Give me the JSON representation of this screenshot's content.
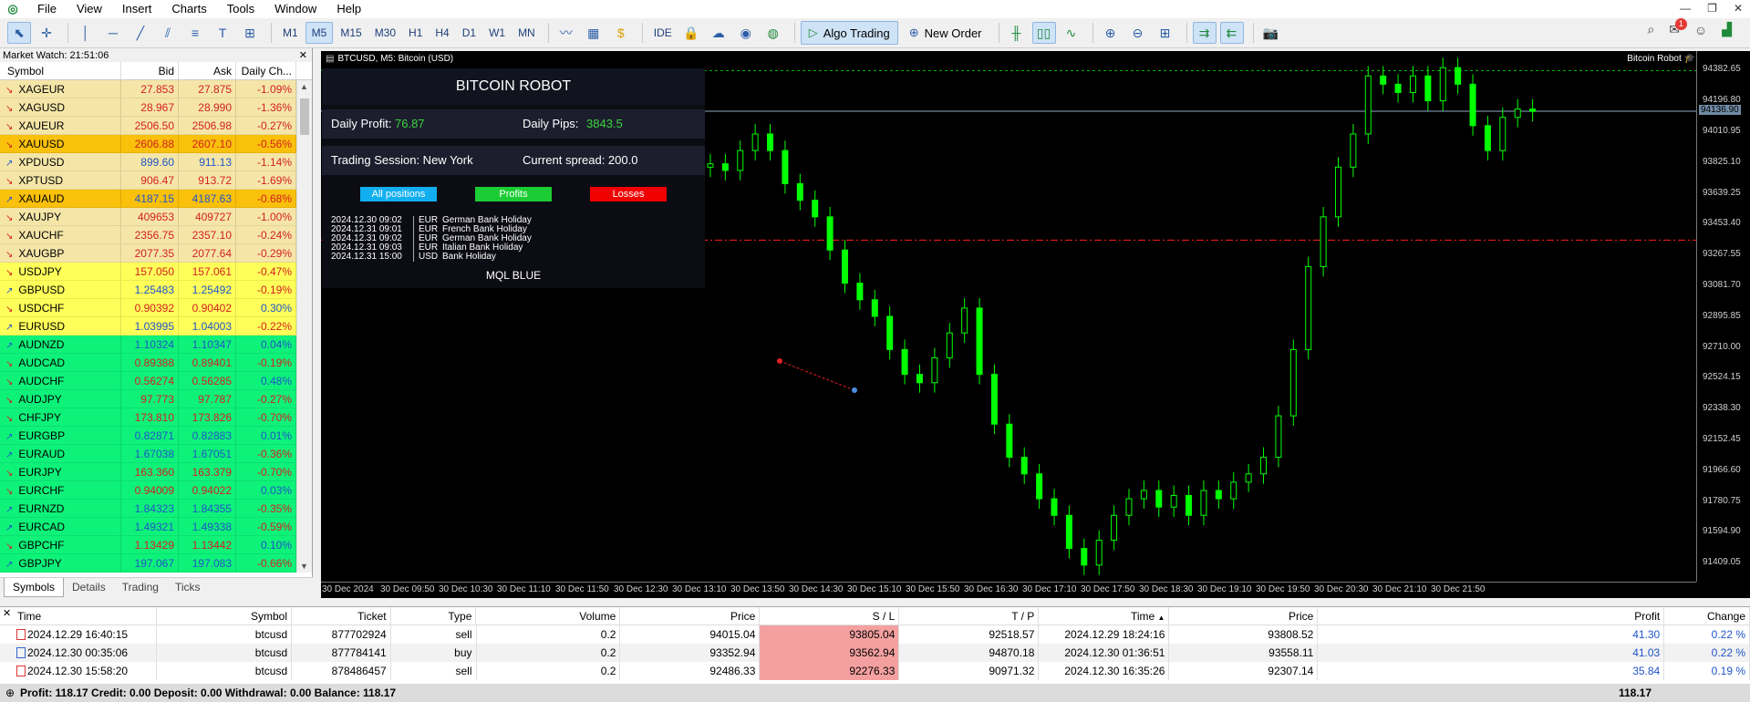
{
  "menu": {
    "items": [
      "File",
      "View",
      "Insert",
      "Charts",
      "Tools",
      "Window",
      "Help"
    ]
  },
  "toolbar": {
    "timeframes": [
      "M1",
      "M5",
      "M15",
      "M30",
      "H1",
      "H4",
      "D1",
      "W1",
      "MN"
    ],
    "active_timeframe": "M5",
    "ide_label": "IDE",
    "algo_trading_label": "Algo Trading",
    "new_order_label": "New Order",
    "notification_count": "1"
  },
  "market_watch": {
    "title": "Market Watch: 21:51:06",
    "columns": [
      "Symbol",
      "Bid",
      "Ask",
      "Daily Ch..."
    ],
    "rows": [
      {
        "symbol": "XAGEUR",
        "bid": "27.853",
        "ask": "27.875",
        "change": "-1.09%",
        "dir": "down",
        "bg": "#f5e6a8"
      },
      {
        "symbol": "XAGUSD",
        "bid": "28.967",
        "ask": "28.990",
        "change": "-1.36%",
        "dir": "down",
        "bg": "#f5e6a8"
      },
      {
        "symbol": "XAUEUR",
        "bid": "2506.50",
        "ask": "2506.98",
        "change": "-0.27%",
        "dir": "down",
        "bg": "#f5e6a8"
      },
      {
        "symbol": "XAUUSD",
        "bid": "2606.88",
        "ask": "2607.10",
        "change": "-0.56%",
        "dir": "down",
        "bg": "#f9c00c"
      },
      {
        "symbol": "XPDUSD",
        "bid": "899.60",
        "ask": "911.13",
        "change": "-1.14%",
        "dir": "up",
        "bg": "#f5e6a8"
      },
      {
        "symbol": "XPTUSD",
        "bid": "906.47",
        "ask": "913.72",
        "change": "-1.69%",
        "dir": "down",
        "bg": "#f5e6a8"
      },
      {
        "symbol": "XAUAUD",
        "bid": "4187.15",
        "ask": "4187.63",
        "change": "-0.68%",
        "dir": "up",
        "bg": "#f9c00c"
      },
      {
        "symbol": "XAUJPY",
        "bid": "409653",
        "ask": "409727",
        "change": "-1.00%",
        "dir": "down",
        "bg": "#f5e6a8"
      },
      {
        "symbol": "XAUCHF",
        "bid": "2356.75",
        "ask": "2357.10",
        "change": "-0.24%",
        "dir": "down",
        "bg": "#f5e6a8"
      },
      {
        "symbol": "XAUGBP",
        "bid": "2077.35",
        "ask": "2077.64",
        "change": "-0.29%",
        "dir": "down",
        "bg": "#f5e6a8"
      },
      {
        "symbol": "USDJPY",
        "bid": "157.050",
        "ask": "157.061",
        "change": "-0.47%",
        "dir": "down",
        "bg": "#ffff5a"
      },
      {
        "symbol": "GBPUSD",
        "bid": "1.25483",
        "ask": "1.25492",
        "change": "-0.19%",
        "dir": "up",
        "bg": "#ffff5a"
      },
      {
        "symbol": "USDCHF",
        "bid": "0.90392",
        "ask": "0.90402",
        "change": "0.30%",
        "dir": "down",
        "bg": "#ffff5a"
      },
      {
        "symbol": "EURUSD",
        "bid": "1.03995",
        "ask": "1.04003",
        "change": "-0.22%",
        "dir": "up",
        "bg": "#ffff5a"
      },
      {
        "symbol": "AUDNZD",
        "bid": "1.10324",
        "ask": "1.10347",
        "change": "0.04%",
        "dir": "up",
        "bg": "#0ef27a"
      },
      {
        "symbol": "AUDCAD",
        "bid": "0.89388",
        "ask": "0.89401",
        "change": "-0.19%",
        "dir": "down",
        "bg": "#0ef27a"
      },
      {
        "symbol": "AUDCHF",
        "bid": "0.56274",
        "ask": "0.56285",
        "change": "0.48%",
        "dir": "down",
        "bg": "#0ef27a"
      },
      {
        "symbol": "AUDJPY",
        "bid": "97.773",
        "ask": "97.787",
        "change": "-0.27%",
        "dir": "down",
        "bg": "#0ef27a"
      },
      {
        "symbol": "CHFJPY",
        "bid": "173.810",
        "ask": "173.826",
        "change": "-0.70%",
        "dir": "down",
        "bg": "#0ef27a"
      },
      {
        "symbol": "EURGBP",
        "bid": "0.82871",
        "ask": "0.82883",
        "change": "0.01%",
        "dir": "up",
        "bg": "#0ef27a"
      },
      {
        "symbol": "EURAUD",
        "bid": "1.67038",
        "ask": "1.67051",
        "change": "-0.36%",
        "dir": "up",
        "bg": "#0ef27a"
      },
      {
        "symbol": "EURJPY",
        "bid": "163.360",
        "ask": "163.379",
        "change": "-0.70%",
        "dir": "down",
        "bg": "#0ef27a"
      },
      {
        "symbol": "EURCHF",
        "bid": "0.94009",
        "ask": "0.94022",
        "change": "0.03%",
        "dir": "down",
        "bg": "#0ef27a"
      },
      {
        "symbol": "EURNZD",
        "bid": "1.84323",
        "ask": "1.84355",
        "change": "-0.35%",
        "dir": "up",
        "bg": "#0ef27a"
      },
      {
        "symbol": "EURCAD",
        "bid": "1.49321",
        "ask": "1.49338",
        "change": "-0.59%",
        "dir": "up",
        "bg": "#0ef27a"
      },
      {
        "symbol": "GBPCHF",
        "bid": "1.13429",
        "ask": "1.13442",
        "change": "0.10%",
        "dir": "down",
        "bg": "#0ef27a"
      },
      {
        "symbol": "GBPJPY",
        "bid": "197.067",
        "ask": "197.083",
        "change": "-0.66%",
        "dir": "up",
        "bg": "#0ef27a"
      }
    ],
    "tabs": [
      "Symbols",
      "Details",
      "Trading",
      "Ticks"
    ],
    "active_tab": "Symbols"
  },
  "chart": {
    "title": "BTCUSD, M5:  Bitcoin (USD)",
    "robot_label": "Bitcoin Robot",
    "current_price_label": "94136.90",
    "price_labels": [
      "94382.65",
      "94196.80",
      "94010.95",
      "93825.10",
      "93639.25",
      "93453.40",
      "93267.55",
      "93081.70",
      "92895.85",
      "92710.00",
      "92524.15",
      "92338.30",
      "92152.45",
      "91966.60",
      "91780.75",
      "91594.90",
      "91409.05"
    ],
    "time_labels": [
      "30 Dec 2024",
      "30 Dec 09:50",
      "30 Dec 10:30",
      "30 Dec 11:10",
      "30 Dec 11:50",
      "30 Dec 12:30",
      "30 Dec 13:10",
      "30 Dec 13:50",
      "30 Dec 14:30",
      "30 Dec 15:10",
      "30 Dec 15:50",
      "30 Dec 16:30",
      "30 Dec 17:10",
      "30 Dec 17:50",
      "30 Dec 18:30",
      "30 Dec 19:10",
      "30 Dec 19:50",
      "30 Dec 20:30",
      "30 Dec 21:10",
      "30 Dec 21:50"
    ],
    "colors": {
      "candle": "#00ff00",
      "background": "#000000",
      "ask_line": "#8fa9c4",
      "stop_line": "#ff2020",
      "tp_line": "#00c000"
    }
  },
  "chart_data": {
    "type": "candlestick",
    "ylim": [
      91300,
      94500
    ],
    "close_series": [
      93700,
      93720,
      93740,
      93760,
      93800,
      93820,
      93780,
      93900,
      94000,
      93900,
      93700,
      93600,
      93500,
      93300,
      93100,
      93000,
      92900,
      92700,
      92550,
      92500,
      92650,
      92800,
      92950,
      92550,
      92250,
      92050,
      91950,
      91800,
      91700,
      91500,
      91400,
      91550,
      91700,
      91800,
      91850,
      91750,
      91820,
      91700,
      91850,
      91800,
      91900,
      91950,
      92050,
      92300,
      92700,
      93200,
      93500,
      93800,
      94000,
      94350,
      94300,
      94250,
      94350,
      94200,
      94400,
      94300,
      94050,
      93900,
      94100,
      94150,
      94136
    ]
  },
  "robot_panel": {
    "title": "BITCOIN ROBOT",
    "daily_profit_label": "Daily Profit:",
    "daily_profit_value": "76.87",
    "daily_pips_label": "Daily Pips:",
    "daily_pips_value": "3843.5",
    "session_label": "Trading Session: New York",
    "spread_label": "Current spread: 200.0",
    "btn_all": "All positions",
    "btn_profits": "Profits",
    "btn_losses": "Losses",
    "events": [
      {
        "date": "2024.12.30 09:02",
        "cur": "EUR",
        "name": "German Bank Holiday"
      },
      {
        "date": "2024.12.31 09:01",
        "cur": "EUR",
        "name": "French Bank Holiday"
      },
      {
        "date": "2024.12.31 09:02",
        "cur": "EUR",
        "name": "German Bank Holiday"
      },
      {
        "date": "2024.12.31 09:03",
        "cur": "EUR",
        "name": "Italian Bank Holiday"
      },
      {
        "date": "2024.12.31 15:00",
        "cur": "USD",
        "name": "Bank Holiday"
      }
    ],
    "footer": "MQL BLUE"
  },
  "trades": {
    "columns": [
      "Time",
      "Symbol",
      "Ticket",
      "Type",
      "Volume",
      "Price",
      "S / L",
      "T / P",
      "Time",
      "Price",
      "Profit",
      "Change"
    ],
    "rows": [
      {
        "time": "2024.12.29 16:40:15",
        "symbol": "btcusd",
        "ticket": "877702924",
        "type": "sell",
        "volume": "0.2",
        "price": "94015.04",
        "sl": "93805.04",
        "tp": "92518.57",
        "time2": "2024.12.29 18:24:16",
        "price2": "93808.52",
        "profit": "41.30",
        "change": "0.22 %"
      },
      {
        "time": "2024.12.30 00:35:06",
        "symbol": "btcusd",
        "ticket": "877784141",
        "type": "buy",
        "volume": "0.2",
        "price": "93352.94",
        "sl": "93562.94",
        "tp": "94870.18",
        "time2": "2024.12.30 01:36:51",
        "price2": "93558.11",
        "profit": "41.03",
        "change": "0.22 %"
      },
      {
        "time": "2024.12.30 15:58:20",
        "symbol": "btcusd",
        "ticket": "878486457",
        "type": "sell",
        "volume": "0.2",
        "price": "92486.33",
        "sl": "92276.33",
        "tp": "90971.32",
        "time2": "2024.12.30 16:35:26",
        "price2": "92307.14",
        "profit": "35.84",
        "change": "0.19 %"
      }
    ],
    "balance_text": "Profit: 118.17  Credit: 0.00  Deposit: 0.00  Withdrawal: 0.00  Balance: 118.17",
    "total_profit": "118.17"
  }
}
